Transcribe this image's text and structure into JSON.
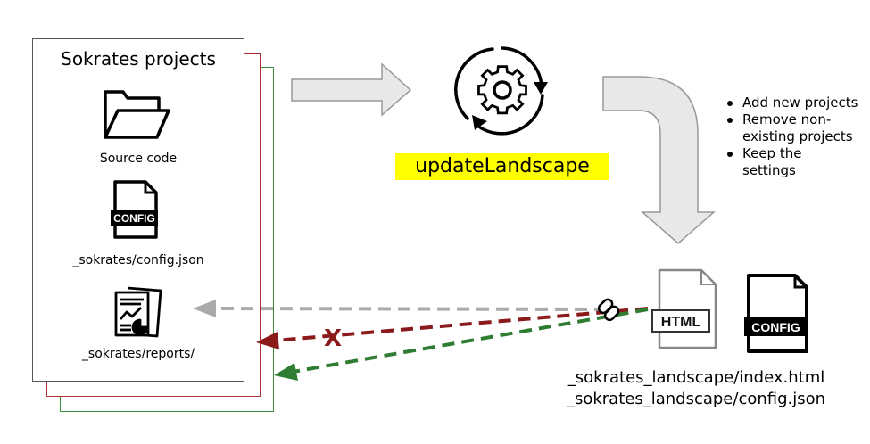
{
  "projects": {
    "title": "Sokrates projects",
    "source_label": "Source code",
    "config_label": "_sokrates/config.json",
    "reports_label": "_sokrates/reports/"
  },
  "config_badge": "CONFIG",
  "process": {
    "label": "updateLandscape",
    "highlight_color": "#ffff00"
  },
  "bullets": [
    "Add new projects",
    "Remove non-existing projects",
    "Keep the settings"
  ],
  "outputs": {
    "html_badge": "HTML",
    "config_badge": "CONFIG",
    "index_path": "_sokrates_landscape/index.html",
    "config_path": "_sokrates_landscape/config.json"
  },
  "blocked_mark": "X",
  "colors": {
    "grey_arrow": "#aaaaaa",
    "red_arrow": "#8b1a1a",
    "green_arrow": "#2e7d32",
    "big_arrow_fill": "#e8e8e8"
  }
}
